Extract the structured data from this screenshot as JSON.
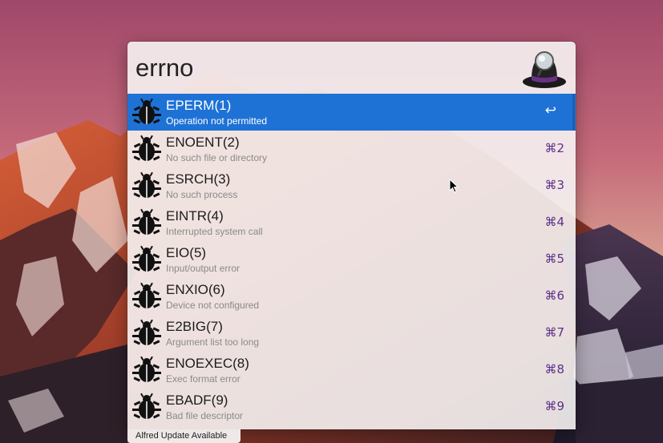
{
  "search": {
    "query": "errno"
  },
  "results": [
    {
      "title": "EPERM(1)",
      "subtitle": "Operation not permitted",
      "shortcut": "↩",
      "icon": "bug-icon",
      "selected": true
    },
    {
      "title": "ENOENT(2)",
      "subtitle": "No such file or directory",
      "shortcut": "⌘2",
      "icon": "bug-icon"
    },
    {
      "title": "ESRCH(3)",
      "subtitle": "No such process",
      "shortcut": "⌘3",
      "icon": "bug-icon"
    },
    {
      "title": "EINTR(4)",
      "subtitle": "Interrupted system call",
      "shortcut": "⌘4",
      "icon": "bug-icon"
    },
    {
      "title": "EIO(5)",
      "subtitle": "Input/output error",
      "shortcut": "⌘5",
      "icon": "bug-icon"
    },
    {
      "title": "ENXIO(6)",
      "subtitle": "Device not configured",
      "shortcut": "⌘6",
      "icon": "bug-icon"
    },
    {
      "title": "E2BIG(7)",
      "subtitle": "Argument list too long",
      "shortcut": "⌘7",
      "icon": "bug-icon"
    },
    {
      "title": "ENOEXEC(8)",
      "subtitle": "Exec format error",
      "shortcut": "⌘8",
      "icon": "bug-icon"
    },
    {
      "title": "EBADF(9)",
      "subtitle": "Bad file descriptor",
      "shortcut": "⌘9",
      "icon": "bug-icon"
    }
  ],
  "update_notice": "Alfred Update Available",
  "colors": {
    "selection": "#1e72d6",
    "shortcut": "#5e2f8a"
  }
}
